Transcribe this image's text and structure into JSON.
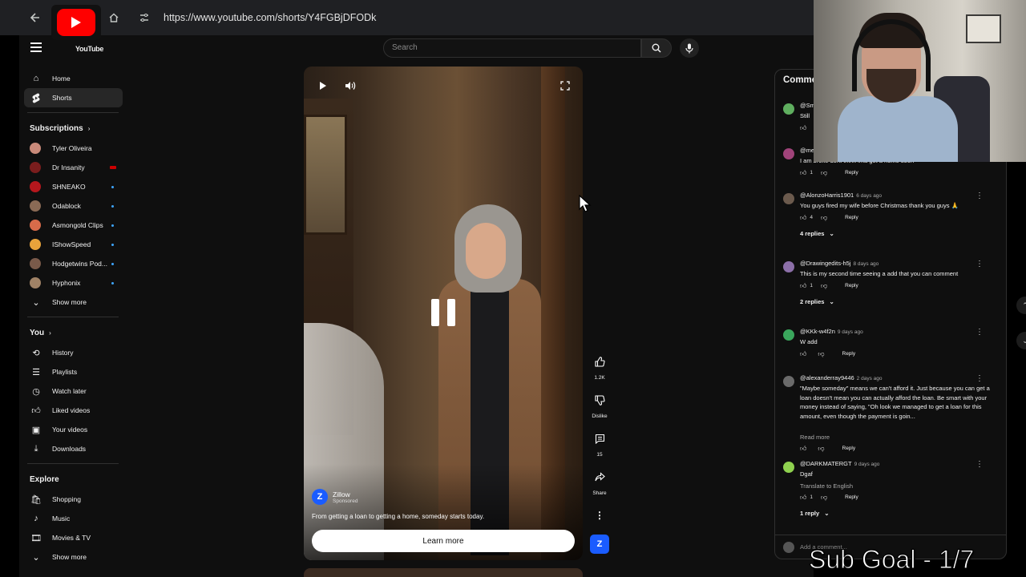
{
  "browser": {
    "url": "https://www.youtube.com/shorts/Y4FGBjDFODk"
  },
  "header": {
    "logo_text": "YouTube",
    "search_placeholder": "Search"
  },
  "sidebar": {
    "main": [
      {
        "label": "Home",
        "icon": "home-icon"
      },
      {
        "label": "Shorts",
        "icon": "shorts-icon",
        "active": true
      }
    ],
    "subscriptions_title": "Subscriptions",
    "subscriptions": [
      {
        "label": "Tyler Oliveira",
        "color": "#c98a7a",
        "badge": "none"
      },
      {
        "label": "Dr Insanity",
        "color": "#7a1d1d",
        "badge": "live"
      },
      {
        "label": "SHNEAKO",
        "color": "#b5171d",
        "badge": "dot"
      },
      {
        "label": "Odablock",
        "color": "#8a6a55",
        "badge": "dot"
      },
      {
        "label": "Asmongold Clips",
        "color": "#d86b4a",
        "badge": "dot"
      },
      {
        "label": "IShowSpeed",
        "color": "#e8a33b",
        "badge": "dot"
      },
      {
        "label": "Hodgetwins Pod...",
        "color": "#7a5a4a",
        "badge": "dot"
      },
      {
        "label": "Hyphonix",
        "color": "#a08266",
        "badge": "dot"
      }
    ],
    "subs_show_more": "Show more",
    "you_title": "You",
    "you": [
      {
        "label": "History",
        "icon": "history-icon"
      },
      {
        "label": "Playlists",
        "icon": "playlists-icon"
      },
      {
        "label": "Watch later",
        "icon": "watch-later-icon"
      },
      {
        "label": "Liked videos",
        "icon": "liked-videos-icon"
      },
      {
        "label": "Your videos",
        "icon": "your-videos-icon"
      },
      {
        "label": "Downloads",
        "icon": "downloads-icon"
      }
    ],
    "explore_title": "Explore",
    "explore": [
      {
        "label": "Shopping",
        "icon": "shopping-icon"
      },
      {
        "label": "Music",
        "icon": "music-icon"
      },
      {
        "label": "Movies & TV",
        "icon": "movies-icon"
      }
    ],
    "explore_show_more": "Show more"
  },
  "video": {
    "advertiser": "Zillow",
    "sponsored": "Sponsored",
    "description": "From getting a loan to getting a home, someday starts today.",
    "cta": "Learn more"
  },
  "actions": {
    "like_count": "1.2K",
    "dislike_label": "Dislike",
    "comment_count": "15",
    "share_label": "Share"
  },
  "comments": {
    "title": "Comments",
    "add_placeholder": "Add a comment...",
    "items": [
      {
        "author": "@Sm",
        "time": "",
        "text": "Still",
        "likes": "",
        "avatar": "#5fae5f",
        "reply": ""
      },
      {
        "author": "@me",
        "time": "",
        "text": "I am broke dont think ima get a home soon",
        "likes": "1",
        "avatar": "#a0437a",
        "reply": "Reply"
      },
      {
        "author": "@AlonzoHarris1901",
        "time": "6 days ago",
        "text": "You guys fired my wife before Christmas thank you guys 🙏",
        "likes": "4",
        "avatar": "#6b5a4d",
        "reply": "Reply",
        "replies": "4 replies"
      },
      {
        "author": "@Drawingedits-h5j",
        "time": "8 days ago",
        "text": "This is my second time seeing a add that you can comment",
        "likes": "1",
        "avatar": "#8c6fa8",
        "reply": "Reply",
        "replies": "2 replies"
      },
      {
        "author": "@KKk-w4f2n",
        "time": "9 days ago",
        "text": "W add",
        "likes": "",
        "avatar": "#3aa65c",
        "reply": "Reply"
      },
      {
        "author": "@alexanderray9446",
        "time": "2 days ago",
        "text": "\"Maybe someday\" means we can't afford it. Just because you can get a loan doesn't mean you can actually afford the loan. Be smart with your money instead of saying, \"Oh look we managed to get a loan for this amount, even though the payment is goin...",
        "likes": "",
        "avatar": "#6a6a6a",
        "reply": "Reply",
        "read_more": "Read more"
      },
      {
        "author": "@DARKMATERGT",
        "time": "9 days ago",
        "text": "Dgaf",
        "likes": "1",
        "avatar": "#8fd14f",
        "reply": "Reply",
        "translate": "Translate to English",
        "replies": "1 reply"
      }
    ]
  },
  "overlay": {
    "sub_goal": "Sub Goal - 1/7"
  }
}
